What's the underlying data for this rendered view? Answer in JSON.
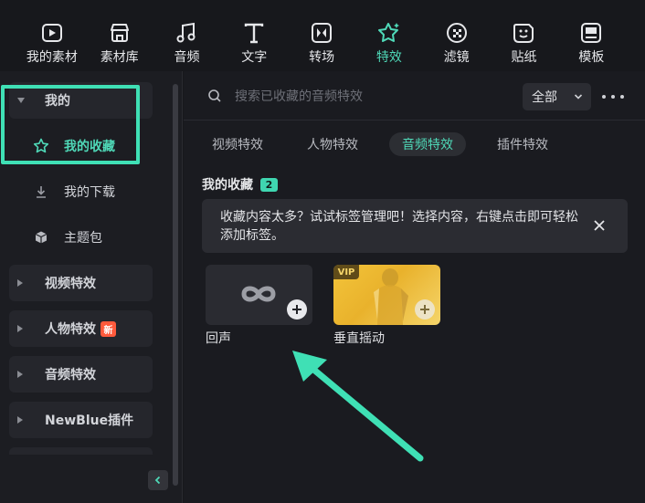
{
  "toolbar": {
    "items": [
      {
        "label": "我的素材",
        "icon": "my-media-icon"
      },
      {
        "label": "素材库",
        "icon": "library-icon"
      },
      {
        "label": "音频",
        "icon": "music-note-icon"
      },
      {
        "label": "文字",
        "icon": "text-icon"
      },
      {
        "label": "转场",
        "icon": "transition-icon"
      },
      {
        "label": "特效",
        "icon": "effects-icon",
        "active": true
      },
      {
        "label": "滤镜",
        "icon": "filter-icon"
      },
      {
        "label": "贴纸",
        "icon": "sticker-icon"
      },
      {
        "label": "模板",
        "icon": "template-icon"
      }
    ],
    "accent": "#4fd9b8"
  },
  "sidebar": {
    "my_group": "我的",
    "favorites": "我的收藏",
    "downloads": "我的下载",
    "theme_pack": "主题包",
    "video_effects": "视频特效",
    "people_effects": "人物特效",
    "new_badge": "新",
    "audio_effects": "音频特效",
    "newblue": "NewBlue插件"
  },
  "search": {
    "placeholder": "搜索已收藏的音频特效",
    "filter_value": "全部"
  },
  "tabs": [
    "视频特效",
    "人物特效",
    "音频特效",
    "插件特效"
  ],
  "active_tab": "音频特效",
  "section": {
    "title": "我的收藏",
    "count": "2"
  },
  "tip": {
    "text": "收藏内容太多？试试标签管理吧！选择内容，右键点击即可轻松添加标签。"
  },
  "cards": [
    {
      "name": "回声",
      "icon": "infinity-icon"
    },
    {
      "name": "垂直摇动",
      "vip": "VIP"
    }
  ],
  "annotation": {
    "highlight_color": "#3fe0b5"
  }
}
